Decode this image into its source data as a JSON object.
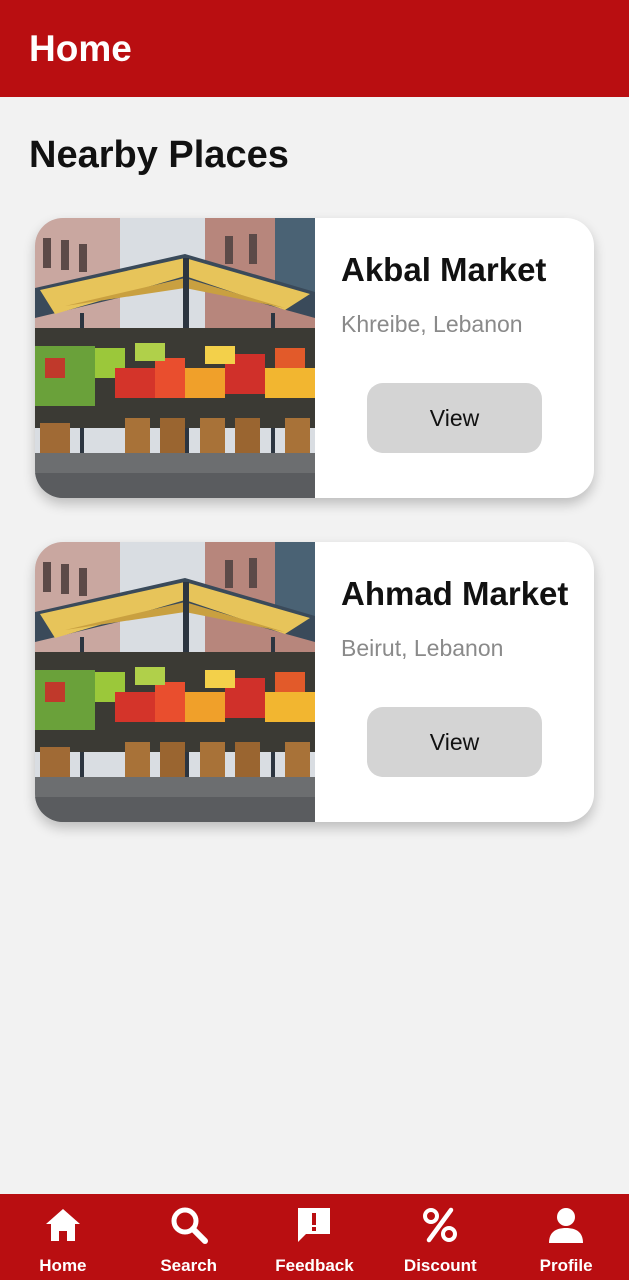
{
  "header": {
    "title": "Home"
  },
  "section": {
    "title": "Nearby Places"
  },
  "places": [
    {
      "name": "Akbal Market",
      "location": "Khreibe, Lebanon",
      "button": "View",
      "image": "market-stall-photo"
    },
    {
      "name": "Ahmad Market",
      "location": "Beirut, Lebanon",
      "button": "View",
      "image": "market-stall-photo"
    }
  ],
  "nav": {
    "items": [
      {
        "label": "Home",
        "icon": "home-icon"
      },
      {
        "label": "Search",
        "icon": "search-icon"
      },
      {
        "label": "Feedback",
        "icon": "feedback-icon"
      },
      {
        "label": "Discount",
        "icon": "percent-icon"
      },
      {
        "label": "Profile",
        "icon": "person-icon"
      }
    ]
  },
  "colors": {
    "primary": "#b90e11",
    "background": "#f2f2f2",
    "card": "#ffffff",
    "button": "#d4d4d4",
    "muted_text": "#8a8a8a"
  }
}
